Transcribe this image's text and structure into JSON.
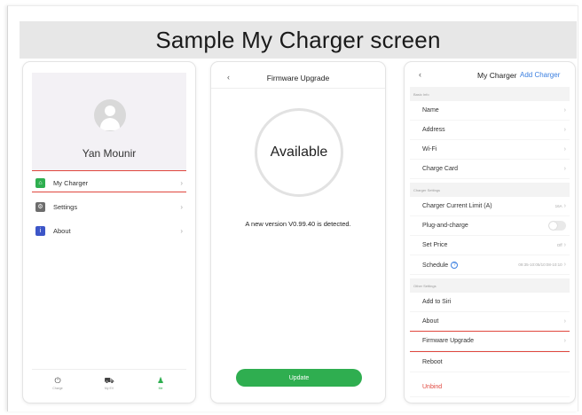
{
  "title": "Sample My Charger screen",
  "profile_screen": {
    "username": "Yan Mounir",
    "menu": [
      {
        "label": "My Charger",
        "icon": "home-icon"
      },
      {
        "label": "Settings",
        "icon": "settings-icon"
      },
      {
        "label": "About",
        "icon": "info-icon"
      }
    ],
    "tabs": [
      {
        "label": "Charge",
        "icon": "power-icon"
      },
      {
        "label": "My EV",
        "icon": "car-icon"
      },
      {
        "label": "Me",
        "icon": "person-icon"
      }
    ]
  },
  "firmware_screen": {
    "title": "Firmware Upgrade",
    "status": "Available",
    "message": "A new version V0.99.40 is detected.",
    "button": "Update"
  },
  "charger_screen": {
    "title": "My Charger",
    "add_link": "Add Charger",
    "sections": {
      "basic": "Basic Info",
      "charger": "Charger Settings",
      "other": "Other Settings"
    },
    "basic_items": [
      "Name",
      "Address",
      "Wi-Fi",
      "Charge Card"
    ],
    "current_limit": {
      "label": "Charger Current Limit (A)",
      "value": "16A"
    },
    "plug_and_charge": "Plug-and-charge",
    "set_price": {
      "label": "Set Price",
      "value": "Off"
    },
    "schedule": {
      "label": "Schedule",
      "value": "09:35-10:05/10:08-10:10"
    },
    "other_items": [
      "Add to Siri",
      "About",
      "Firmware Upgrade",
      "Reboot"
    ],
    "unbind": "Unbind"
  },
  "colors": {
    "accent_green": "#2fae50",
    "link_blue": "#3b7fe0",
    "highlight_red": "#e0473e"
  }
}
